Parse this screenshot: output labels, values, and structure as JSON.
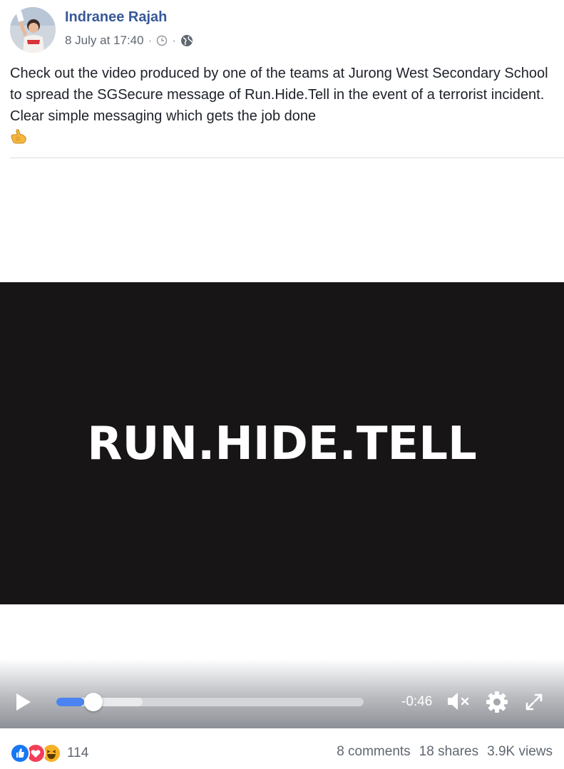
{
  "post": {
    "author": "Indranee Rajah",
    "date": "8 July at 17:40",
    "separator": "·",
    "text": "Check out the video produced by one of the teams at Jurong West Secondary School to spread the SGSecure message of Run.Hide.Tell in the event of a terrorist incident. Clear simple messaging which gets the job done"
  },
  "video": {
    "title_text": "RUN.HIDE.TELL",
    "time_remaining": "-0:46",
    "progress_played": 0.09,
    "progress_buffered": 0.28
  },
  "footer": {
    "reaction_count": "114",
    "comments": "8 comments",
    "shares": "18 shares",
    "views": "3.9K views"
  },
  "colors": {
    "link_blue": "#385898",
    "progress_blue": "#4b84f0",
    "like_blue": "#1877f2",
    "love_red": "#f33e58",
    "haha_yellow": "#f7b125"
  },
  "icons": {
    "clock": "clock-icon",
    "globe": "globe-icon",
    "emoji": "pointing-hand-emoji-icon",
    "play": "play-icon",
    "mute": "volume-muted-icon",
    "settings": "gear-icon",
    "fullscreen": "expand-icon"
  }
}
